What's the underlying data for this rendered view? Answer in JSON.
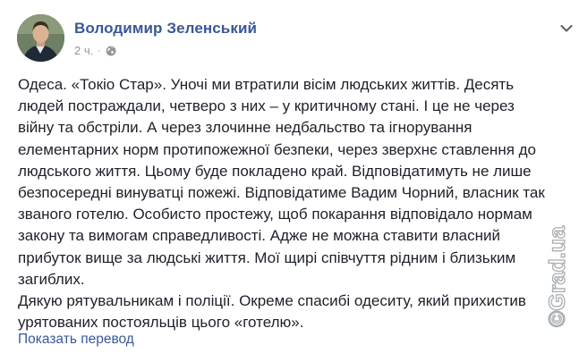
{
  "post": {
    "author": "Володимир Зеленський",
    "time": "2 ч.",
    "separator": "·",
    "audience_icon": "globe-icon",
    "menu_icon": "chevron-down-icon",
    "body": [
      "Одеса. «Токіо Стар». Уночі ми втратили вісім людських життів. Десять людей постраждали, четверо з них – у критичному стані. І це не через війну та обстріли. А через злочинне недбальство та ігнорування елементарних норм протипожежної безпеки, через зверхнє ставлення до людського життя. Цьому буде покладено край. Відповідатимуть не лише безпосередні винуватці пожежі. Відповідатиме Вадим Чорний, власник так званого готелю. Особисто простежу, щоб покарання відповідало нормам закону та вимогам справедливості. Адже не можна ставити власний прибуток вище за людські життя. Мої щирі співчуття рідним і близьким загиблих.",
      "Дякую рятувальникам і поліції. Окреме спасибі одеситу, який прихистив урятованих постояльців цього «готелю»."
    ],
    "translate_link": "Показать перевод"
  },
  "watermark": {
    "text": "Grad.ua",
    "symbol": "©"
  },
  "colors": {
    "author": "#385898",
    "meta": "#90949c",
    "text": "#1d2129",
    "link": "#385898"
  }
}
